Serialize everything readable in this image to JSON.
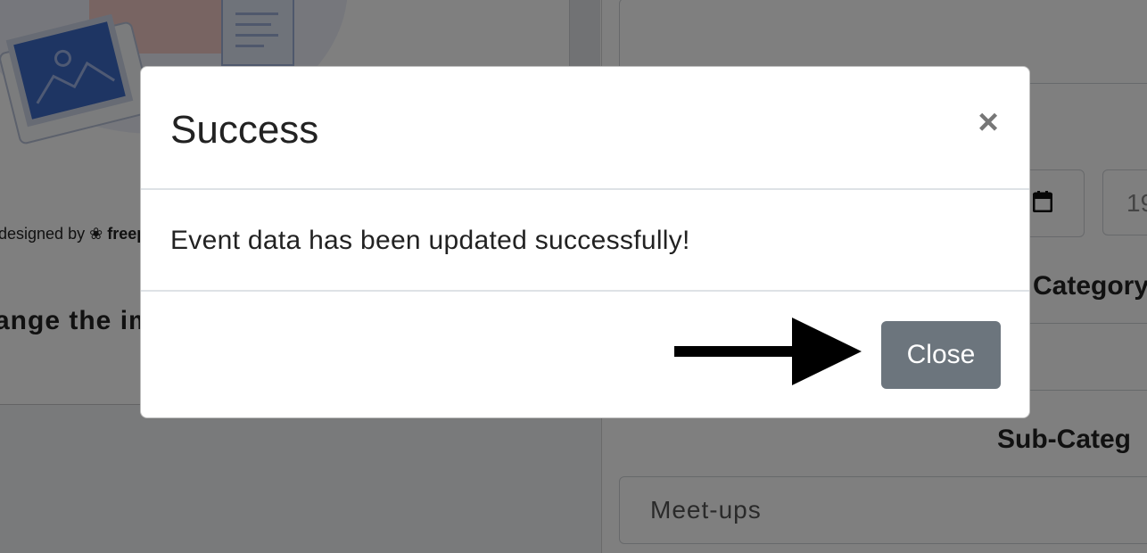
{
  "background": {
    "credit_prefix": "designed by",
    "credit_brand": "freep",
    "change_text": "ange the im",
    "time_value": "19",
    "category_label": "Category",
    "subcategory_label": "Sub-Categ",
    "subcategory_value": "Meet-ups"
  },
  "modal": {
    "title": "Success",
    "close_icon": "×",
    "message": "Event data has been updated successfully!",
    "close_button_label": "Close",
    "close_button_color": "#6c757d"
  },
  "annotation": {
    "arrow_icon": "right-arrow-icon",
    "arrow_color": "#000000"
  }
}
